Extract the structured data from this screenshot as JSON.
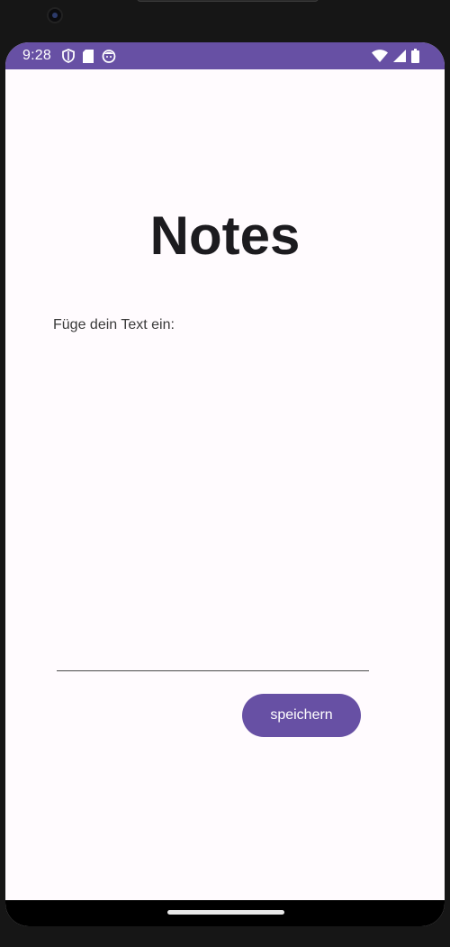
{
  "status_bar": {
    "time": "9:28",
    "color": "#6750a4",
    "left_icons": [
      "shield-icon",
      "sd-card-icon",
      "app-notification-icon"
    ],
    "right_icons": [
      "wifi-icon",
      "cell-signal-icon",
      "battery-icon"
    ]
  },
  "app": {
    "title": "Notes",
    "prompt_label": "Füge dein Text ein:",
    "note_input": {
      "value": "",
      "placeholder": ""
    },
    "save_button_label": "speichern",
    "accent_color": "#6750a4",
    "background_color": "#fffbfe"
  }
}
